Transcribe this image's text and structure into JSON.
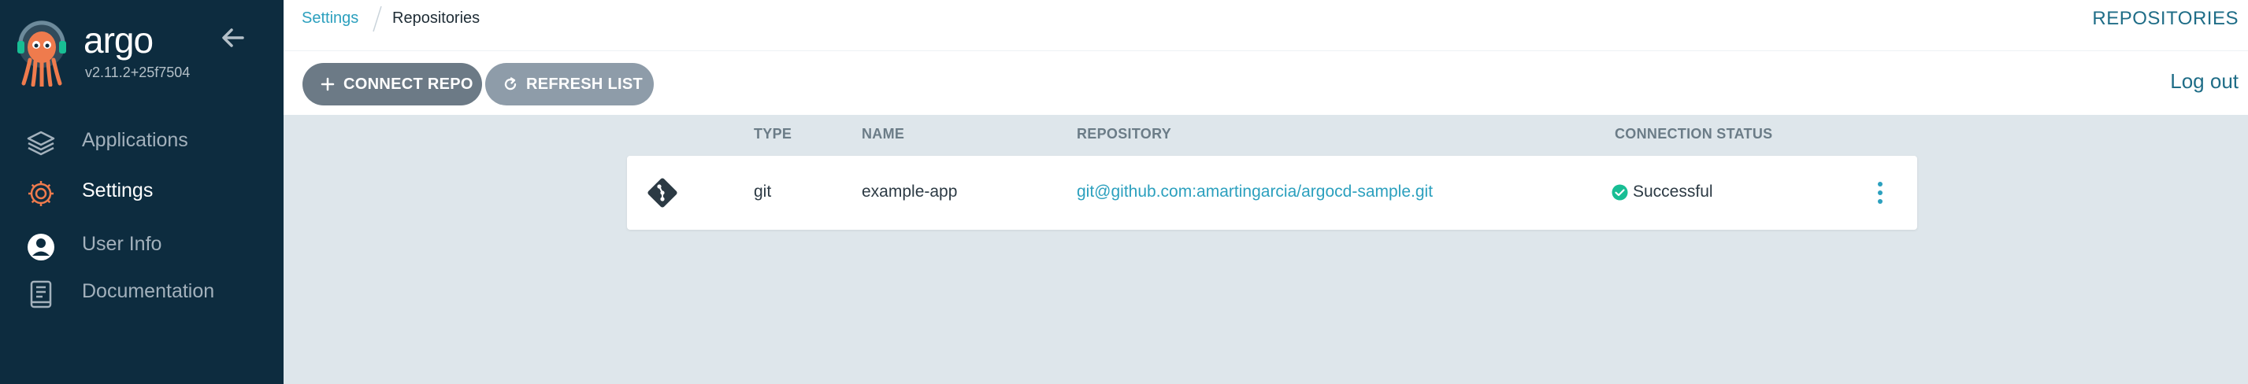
{
  "app": {
    "name": "argo",
    "version": "v2.11.2+25f7504"
  },
  "sidebar": {
    "items": [
      {
        "label": "Applications",
        "icon": "layers-icon"
      },
      {
        "label": "Settings",
        "icon": "gear-icon"
      },
      {
        "label": "User Info",
        "icon": "user-icon"
      },
      {
        "label": "Documentation",
        "icon": "book-icon"
      }
    ],
    "active": "Settings"
  },
  "header": {
    "breadcrumb": [
      "Settings",
      "Repositories"
    ],
    "title": "REPOSITORIES",
    "logout_label": "Log out"
  },
  "toolbar": {
    "connect_label": "CONNECT REPO",
    "refresh_label": "REFRESH LIST"
  },
  "table": {
    "columns": [
      "TYPE",
      "NAME",
      "REPOSITORY",
      "CONNECTION STATUS"
    ],
    "rows": [
      {
        "type": "git",
        "name": "example-app",
        "repository": "git@github.com:amartingarcia/argocd-sample.git",
        "status": "Successful"
      }
    ]
  },
  "colors": {
    "sidebar_bg": "#0d2c3f",
    "accent": "#2ca0be",
    "success": "#18be94",
    "content_bg": "#dee6eb"
  }
}
